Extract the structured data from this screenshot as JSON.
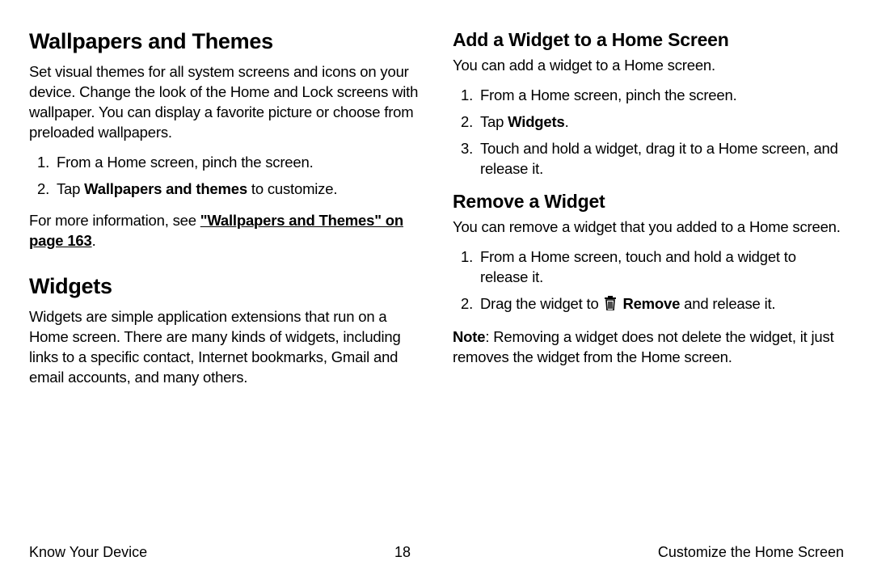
{
  "left": {
    "h1a": "Wallpapers and Themes",
    "p1": "Set visual themes for all system screens and icons on your device. Change the look of the Home and Lock screens with wallpaper. You can display a favorite picture or choose from preloaded wallpapers.",
    "ol1_1": "From a Home screen, pinch the screen.",
    "ol1_2a": "Tap ",
    "ol1_2b": "Wallpapers and themes",
    "ol1_2c": " to customize.",
    "p2a": "For more information, see ",
    "p2b": "\"Wallpapers and Themes\" on page 163",
    "p2c": ".",
    "h1b": "Widgets",
    "p3": "Widgets are simple application extensions that run on a Home screen. There are many kinds of widgets, including links to a specific contact, Internet bookmarks, Gmail and email accounts, and many others."
  },
  "right": {
    "h2a": "Add a Widget to a Home Screen",
    "p1": "You can add a widget to a Home screen.",
    "ol1_1": "From a Home screen, pinch the screen.",
    "ol1_2a": "Tap ",
    "ol1_2b": "Widgets",
    "ol1_2c": ".",
    "ol1_3": "Touch and hold a widget, drag it to a Home screen, and release it.",
    "h2b": "Remove a Widget",
    "p2": "You can remove a widget that you added to a Home screen.",
    "ol2_1": "From a Home screen, touch and hold a widget to release it.",
    "ol2_2a": "Drag the widget to ",
    "ol2_2b": "Remove",
    "ol2_2c": " and release it.",
    "note_a": "Note",
    "note_b": ": Removing a widget does not delete the widget, it just removes the widget from the Home screen."
  },
  "footer": {
    "left": "Know Your Device",
    "center": "18",
    "right": "Customize the Home Screen"
  }
}
